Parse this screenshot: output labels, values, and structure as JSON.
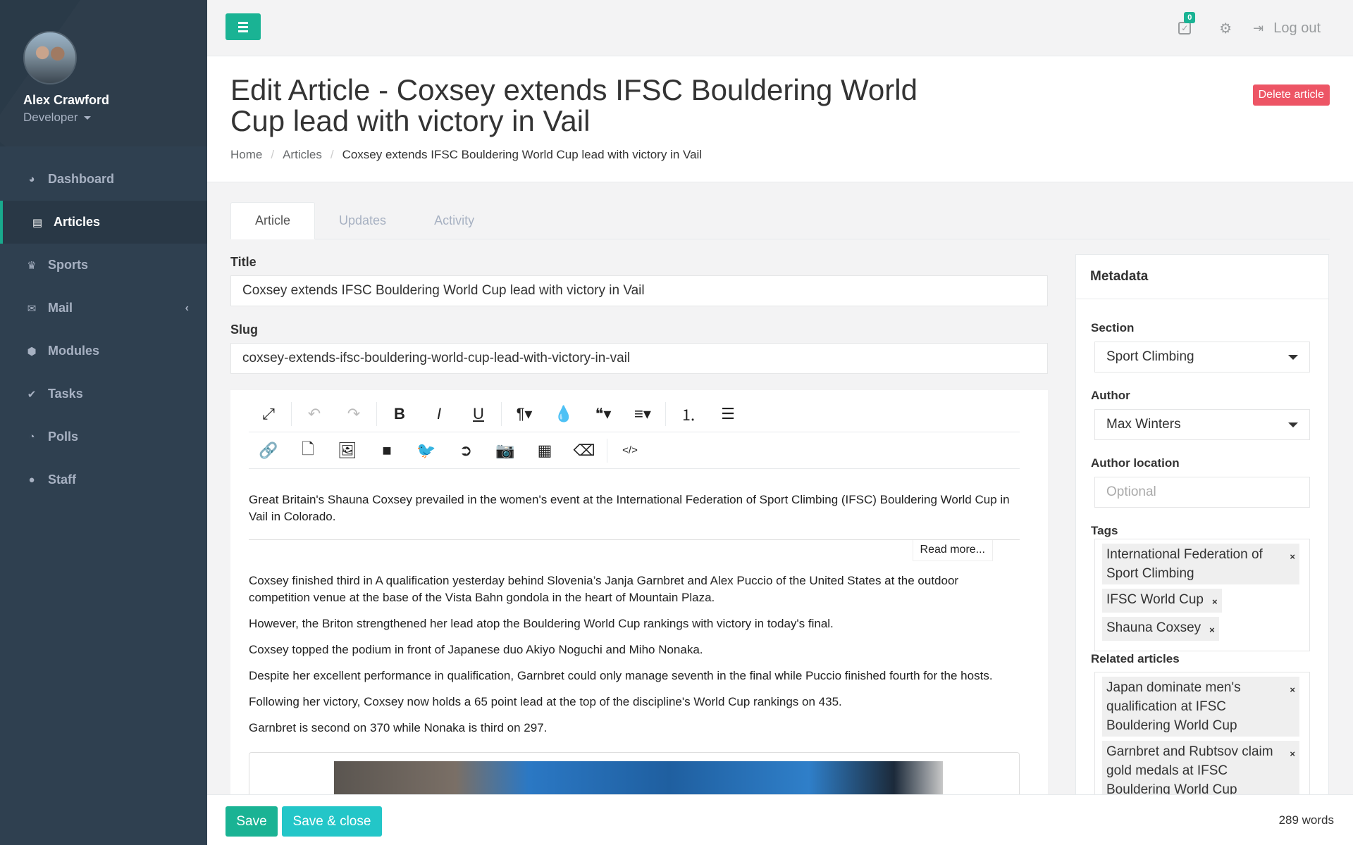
{
  "user": {
    "name": "Alex Crawford",
    "role": "Developer"
  },
  "nav": [
    {
      "label": "Dashboard",
      "icon": "dashboard-icon",
      "glyph": "◕"
    },
    {
      "label": "Articles",
      "icon": "newspaper-icon",
      "glyph": "▤"
    },
    {
      "label": "Sports",
      "icon": "trophy-icon",
      "glyph": "♛"
    },
    {
      "label": "Mail",
      "icon": "envelope-icon",
      "glyph": "✉"
    },
    {
      "label": "Modules",
      "icon": "cubes-icon",
      "glyph": "⬢"
    },
    {
      "label": "Tasks",
      "icon": "check-icon",
      "glyph": "✔"
    },
    {
      "label": "Polls",
      "icon": "pie-chart-icon",
      "glyph": "◔"
    },
    {
      "label": "Staff",
      "icon": "user-icon",
      "glyph": "●"
    }
  ],
  "topbar": {
    "task_count": "0",
    "logout_label": "Log out"
  },
  "header": {
    "title": "Edit Article - Coxsey extends IFSC Bouldering World Cup lead with victory in Vail",
    "delete_label": "Delete article",
    "breadcrumb": [
      "Home",
      "Articles",
      "Coxsey extends IFSC Bouldering World Cup lead with victory in Vail"
    ]
  },
  "tabs": [
    "Article",
    "Updates",
    "Activity"
  ],
  "form": {
    "title_label": "Title",
    "title_value": "Coxsey extends IFSC Bouldering World Cup lead with victory in Vail",
    "slug_label": "Slug",
    "slug_value": "coxsey-extends-ifsc-bouldering-world-cup-lead-with-victory-in-vail"
  },
  "toolbar": {
    "row1": [
      {
        "name": "fullscreen-icon",
        "glyph": "⤢",
        "disabled": false
      },
      {
        "name": "undo-icon",
        "glyph": "↶",
        "disabled": true
      },
      {
        "name": "redo-icon",
        "glyph": "↷",
        "disabled": true
      },
      {
        "name": "bold-icon",
        "glyph": "B",
        "disabled": false
      },
      {
        "name": "italic-icon",
        "glyph": "I",
        "disabled": false
      },
      {
        "name": "underline-icon",
        "glyph": "U",
        "disabled": false
      },
      {
        "name": "paragraph-icon",
        "glyph": "¶▾",
        "disabled": false
      },
      {
        "name": "color-icon",
        "glyph": "💧",
        "disabled": false
      },
      {
        "name": "quote-icon",
        "glyph": "❝▾",
        "disabled": false
      },
      {
        "name": "align-icon",
        "glyph": "≡▾",
        "disabled": false
      },
      {
        "name": "ordered-list-icon",
        "glyph": "⒈",
        "disabled": false
      },
      {
        "name": "unordered-list-icon",
        "glyph": "☰",
        "disabled": false
      }
    ],
    "row2": [
      {
        "name": "link-icon",
        "glyph": "🔗"
      },
      {
        "name": "file-icon",
        "glyph": "🗋"
      },
      {
        "name": "image-icon",
        "glyph": "🖼"
      },
      {
        "name": "video-icon",
        "glyph": "■"
      },
      {
        "name": "twitter-icon",
        "glyph": "🐦"
      },
      {
        "name": "embed-icon",
        "glyph": "➲"
      },
      {
        "name": "camera-icon",
        "glyph": "📷"
      },
      {
        "name": "table-icon",
        "glyph": "▦"
      },
      {
        "name": "eraser-icon",
        "glyph": "⌫"
      },
      {
        "name": "code-icon",
        "glyph": "</>"
      }
    ]
  },
  "body": {
    "intro": "Great Britain's Shauna Coxsey prevailed in the women's event at the International Federation of Sport Climbing (IFSC) Bouldering World Cup in Vail in Colorado.",
    "read_more": "Read more...",
    "paragraphs": [
      "Coxsey finished third in A qualification yesterday behind Slovenia’s Janja Garnbret and Alex Puccio of the United States at the outdoor competition venue at the base of the Vista Bahn gondola in the heart of Mountain Plaza.",
      "However, the Briton strengthened her lead atop the Bouldering World Cup rankings with victory in today's final.",
      "Coxsey topped the podium in front of Japanese duo Akiyo Noguchi and Miho Nonaka.",
      "Despite her excellent performance in qualification, Garnbret could only manage seventh in the final while Puccio finished fourth for the hosts.",
      "Following her victory, Coxsey now holds a 65 point lead at the top of the discipline's World Cup rankings on 435.",
      "Garnbret is second on 370 while Nonaka is third on 297."
    ]
  },
  "metadata": {
    "title": "Metadata",
    "section_label": "Section",
    "section_value": "Sport Climbing",
    "author_label": "Author",
    "author_value": "Max Winters",
    "location_label": "Author location",
    "location_placeholder": "Optional",
    "tags_label": "Tags",
    "tags": [
      "International Federation of Sport Climbing",
      "IFSC World Cup",
      "Shauna Coxsey"
    ],
    "related_label": "Related articles",
    "related": [
      "Japan dominate men's qualification at IFSC Bouldering World Cup",
      "Garnbret and Rubtsov claim gold medals at IFSC Bouldering World Cup"
    ]
  },
  "footer": {
    "save_label": "Save",
    "save_close_label": "Save & close",
    "word_count": "289 words"
  },
  "colors": {
    "primary": "#1ab394",
    "info": "#23c6c8",
    "danger": "#ed5565",
    "sidebar": "#2f4050"
  }
}
